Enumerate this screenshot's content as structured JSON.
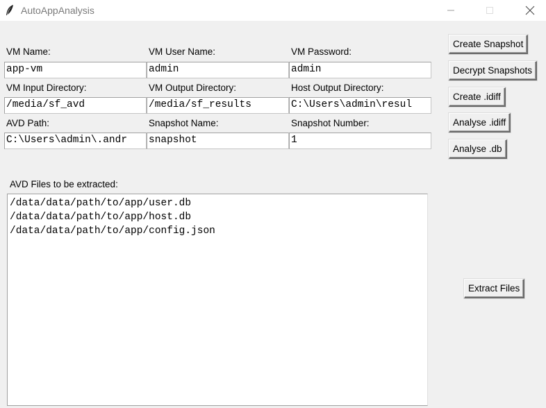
{
  "window": {
    "title": "AutoAppAnalysis",
    "minimize_glyph": "—",
    "maximize_glyph": "☐",
    "close_glyph": "✕"
  },
  "form": {
    "vm_name": {
      "label": "VM Name:",
      "value": "app-vm"
    },
    "vm_user_name": {
      "label": "VM User Name:",
      "value": "admin"
    },
    "vm_password": {
      "label": "VM Password:",
      "value": "admin"
    },
    "vm_input_directory": {
      "label": "VM Input Directory:",
      "value": "/media/sf_avd"
    },
    "vm_output_directory": {
      "label": "VM Output Directory:",
      "value": "/media/sf_results"
    },
    "host_output_directory": {
      "label": "Host Output Directory:",
      "value": "C:\\Users\\admin\\resul"
    },
    "avd_path": {
      "label": "AVD Path:",
      "value": "C:\\Users\\admin\\.andr"
    },
    "snapshot_name": {
      "label": "Snapshot Name:",
      "value": "snapshot"
    },
    "snapshot_number": {
      "label": "Snapshot Number:",
      "value": "1"
    }
  },
  "buttons": {
    "create_snapshot": "Create Snapshot",
    "decrypt_snapshots": "Decrypt Snapshots",
    "create_idiff": "Create .idiff",
    "analyse_idiff": "Analyse .idiff",
    "analyse_db": "Analyse .db",
    "extract_files": "Extract Files"
  },
  "avd_files": {
    "label": "AVD Files to be extracted:",
    "lines": [
      "/data/data/path/to/app/user.db",
      "/data/data/path/to/app/host.db",
      "/data/data/path/to/app/config.json"
    ]
  },
  "colors": {
    "background": "#f0f0f0",
    "titlebar": "#ffffff",
    "entry_background": "#ffffff"
  },
  "icons": {
    "app": "feather-icon",
    "minimize": "minimize-icon",
    "maximize": "maximize-icon",
    "close": "close-icon"
  }
}
